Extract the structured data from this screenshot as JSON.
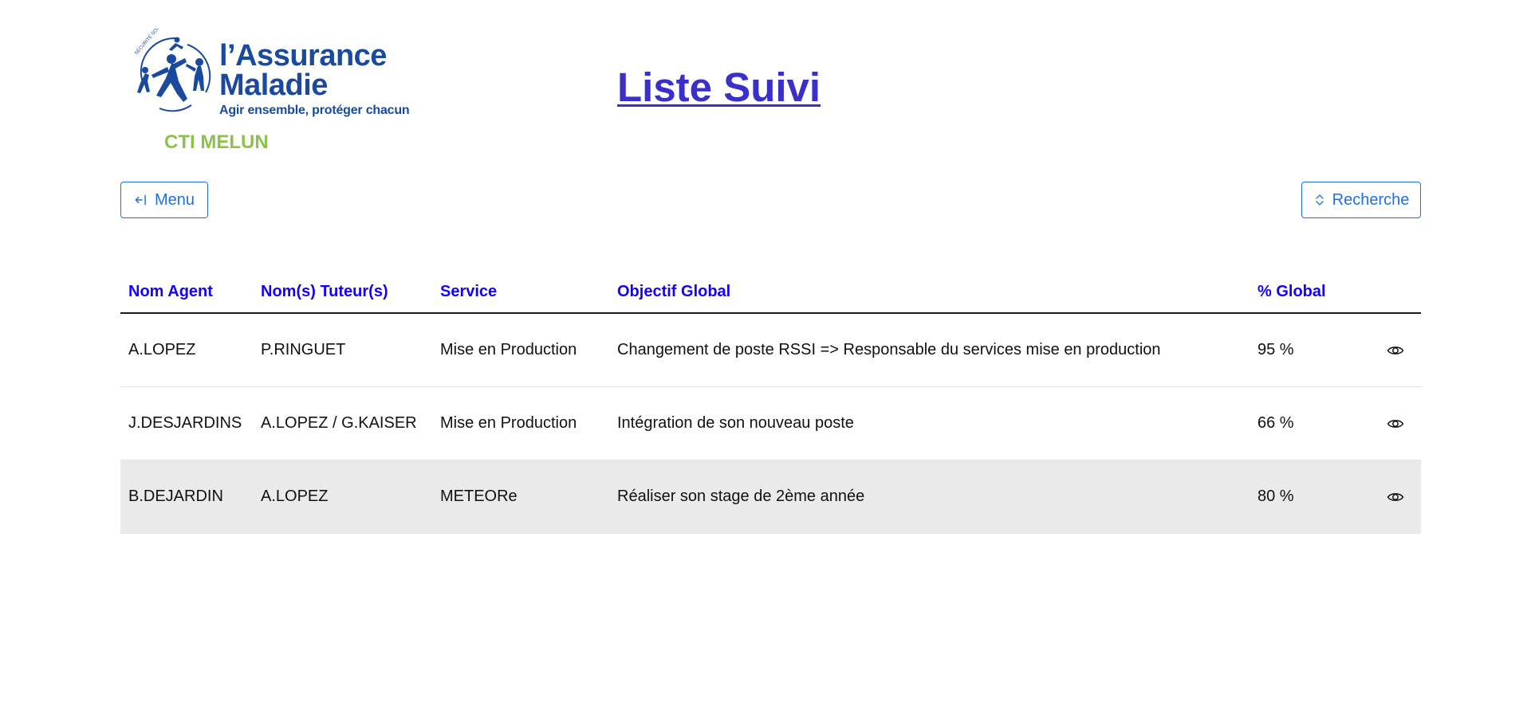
{
  "header": {
    "logo": {
      "line1": "l’Assurance",
      "line2": "Maladie",
      "tagline": "Agir ensemble, protéger chacun",
      "emblem_text": "SÉCURITÉ SOCIALE",
      "brand_color": "#1a4a9e"
    },
    "site_label": "CTI MELUN",
    "title": "Liste Suivi"
  },
  "toolbar": {
    "menu_label": "Menu",
    "menu_icon": "arrow-bar-left-icon",
    "search_label": "Recherche",
    "search_icon": "chevron-expand-icon"
  },
  "table": {
    "columns": [
      "Nom Agent",
      "Nom(s) Tuteur(s)",
      "Service",
      "Objectif Global",
      "% Global",
      ""
    ],
    "rows": [
      {
        "agent": "A.LOPEZ",
        "tutors": "P.RINGUET",
        "service": "Mise en Production",
        "objective": "Changement de poste RSSI => Responsable du services mise en production",
        "percent": "95 %",
        "action_icon": "eye-icon"
      },
      {
        "agent": "J.DESJARDINS",
        "tutors": "A.LOPEZ / G.KAISER",
        "service": "Mise en Production",
        "objective": "Intégration de son nouveau poste",
        "percent": "66 %",
        "action_icon": "eye-icon"
      },
      {
        "agent": "B.DEJARDIN",
        "tutors": "A.LOPEZ",
        "service": "METEORe",
        "objective": "Réaliser son stage de 2ème année",
        "percent": "80 %",
        "action_icon": "eye-icon",
        "highlighted": true
      }
    ]
  },
  "colors": {
    "title": "#3b2fc9",
    "header_text": "#1500ff",
    "button": "#1f6fe0",
    "site_label": "#8bc34a",
    "row_highlight": "#ebeaea"
  }
}
